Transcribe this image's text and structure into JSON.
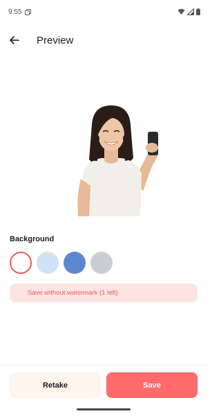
{
  "status_bar": {
    "time": "9:55",
    "icons": [
      "sim-card-icon",
      "wifi-icon",
      "signal-icon",
      "battery-icon"
    ]
  },
  "app_bar": {
    "title": "Preview",
    "back_icon": "arrow-left-icon"
  },
  "background": {
    "label": "Background",
    "options": [
      {
        "name": "white",
        "color": "#ffffff",
        "selected": true
      },
      {
        "name": "light-blue",
        "color": "#cfe3f5",
        "selected": false
      },
      {
        "name": "blue",
        "color": "#5b87cf",
        "selected": false
      },
      {
        "name": "gray",
        "color": "#c9ced3",
        "selected": false
      }
    ]
  },
  "watermark": {
    "label": "Save without watermark (1 left)"
  },
  "actions": {
    "retake_label": "Retake",
    "save_label": "Save"
  },
  "colors": {
    "accent": "#ff6b6b",
    "accent_light": "#fde4e3",
    "retake_bg": "#fff5ef"
  }
}
